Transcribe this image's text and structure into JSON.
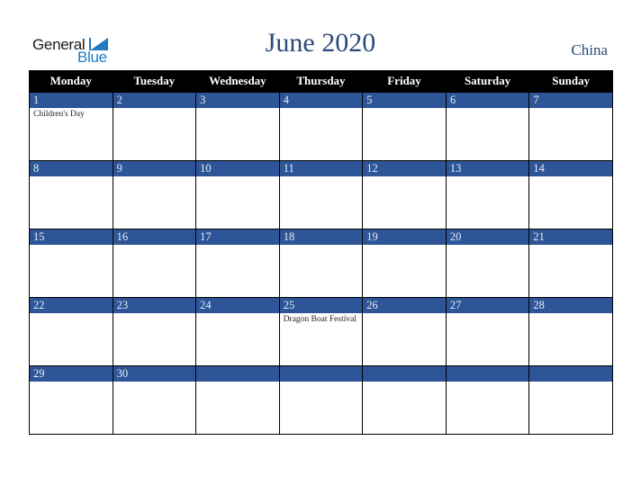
{
  "logo": {
    "line1": "General",
    "line2": "Blue"
  },
  "header": {
    "title": "June 2020",
    "country": "China"
  },
  "colors": {
    "accent": "#2d5597",
    "title": "#2b4a7a",
    "header_bg": "#000000",
    "logo_blue": "#1e7bc4"
  },
  "weekdays": [
    "Monday",
    "Tuesday",
    "Wednesday",
    "Thursday",
    "Friday",
    "Saturday",
    "Sunday"
  ],
  "weeks": [
    [
      {
        "day": "1",
        "event": "Children's Day"
      },
      {
        "day": "2",
        "event": ""
      },
      {
        "day": "3",
        "event": ""
      },
      {
        "day": "4",
        "event": ""
      },
      {
        "day": "5",
        "event": ""
      },
      {
        "day": "6",
        "event": ""
      },
      {
        "day": "7",
        "event": ""
      }
    ],
    [
      {
        "day": "8",
        "event": ""
      },
      {
        "day": "9",
        "event": ""
      },
      {
        "day": "10",
        "event": ""
      },
      {
        "day": "11",
        "event": ""
      },
      {
        "day": "12",
        "event": ""
      },
      {
        "day": "13",
        "event": ""
      },
      {
        "day": "14",
        "event": ""
      }
    ],
    [
      {
        "day": "15",
        "event": ""
      },
      {
        "day": "16",
        "event": ""
      },
      {
        "day": "17",
        "event": ""
      },
      {
        "day": "18",
        "event": ""
      },
      {
        "day": "19",
        "event": ""
      },
      {
        "day": "20",
        "event": ""
      },
      {
        "day": "21",
        "event": ""
      }
    ],
    [
      {
        "day": "22",
        "event": ""
      },
      {
        "day": "23",
        "event": ""
      },
      {
        "day": "24",
        "event": ""
      },
      {
        "day": "25",
        "event": "Dragon Boat Festival"
      },
      {
        "day": "26",
        "event": ""
      },
      {
        "day": "27",
        "event": ""
      },
      {
        "day": "28",
        "event": ""
      }
    ],
    [
      {
        "day": "29",
        "event": ""
      },
      {
        "day": "30",
        "event": ""
      },
      {
        "day": "",
        "event": ""
      },
      {
        "day": "",
        "event": ""
      },
      {
        "day": "",
        "event": ""
      },
      {
        "day": "",
        "event": ""
      },
      {
        "day": "",
        "event": ""
      }
    ]
  ]
}
